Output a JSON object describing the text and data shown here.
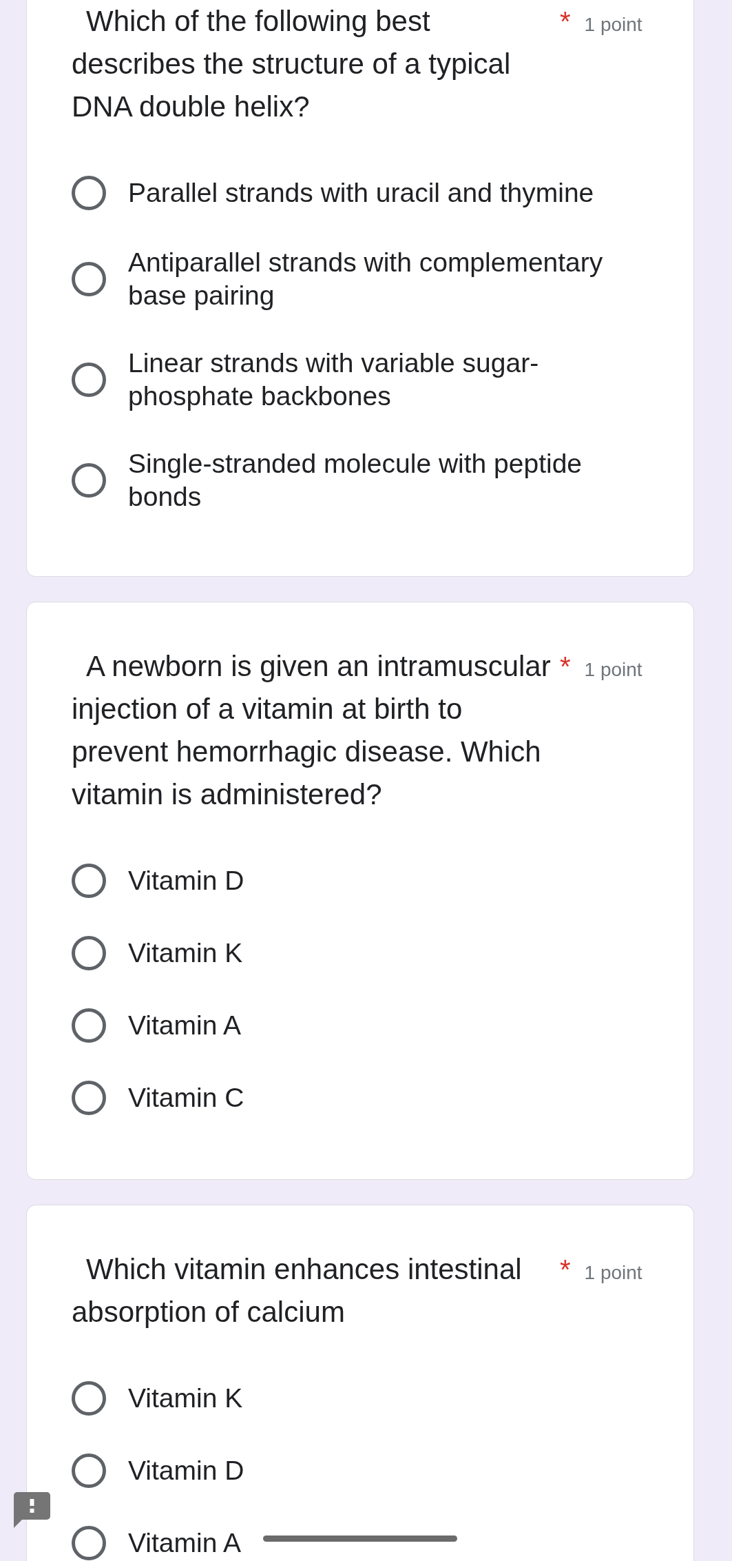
{
  "questions": [
    {
      "text": "Which of the following best describes the structure of a typical DNA double helix?",
      "required_mark": "*",
      "points": "1 point",
      "options": [
        {
          "label": "Parallel strands with uracil and thymine",
          "selected": false
        },
        {
          "label": "Antiparallel strands with complementary base pairing",
          "selected": false
        },
        {
          "label": "Linear strands with variable sugar-phosphate backbones",
          "selected": false
        },
        {
          "label": "Single-stranded molecule with peptide bonds",
          "selected": false
        }
      ]
    },
    {
      "text": "A newborn is given an intramuscular injection of a vitamin at birth to prevent hemorrhagic disease. Which vitamin is administered?",
      "required_mark": "*",
      "points": "1 point",
      "options": [
        {
          "label": "Vitamin D",
          "selected": false
        },
        {
          "label": "Vitamin K",
          "selected": false
        },
        {
          "label": "Vitamin A",
          "selected": false
        },
        {
          "label": "Vitamin C",
          "selected": false
        }
      ]
    },
    {
      "text": "Which vitamin enhances intestinal absorption of calcium",
      "required_mark": "*",
      "points": "1 point",
      "options": [
        {
          "label": "Vitamin K",
          "selected": false
        },
        {
          "label": "Vitamin D",
          "selected": false
        },
        {
          "label": "Vitamin A",
          "selected": false
        }
      ]
    }
  ]
}
